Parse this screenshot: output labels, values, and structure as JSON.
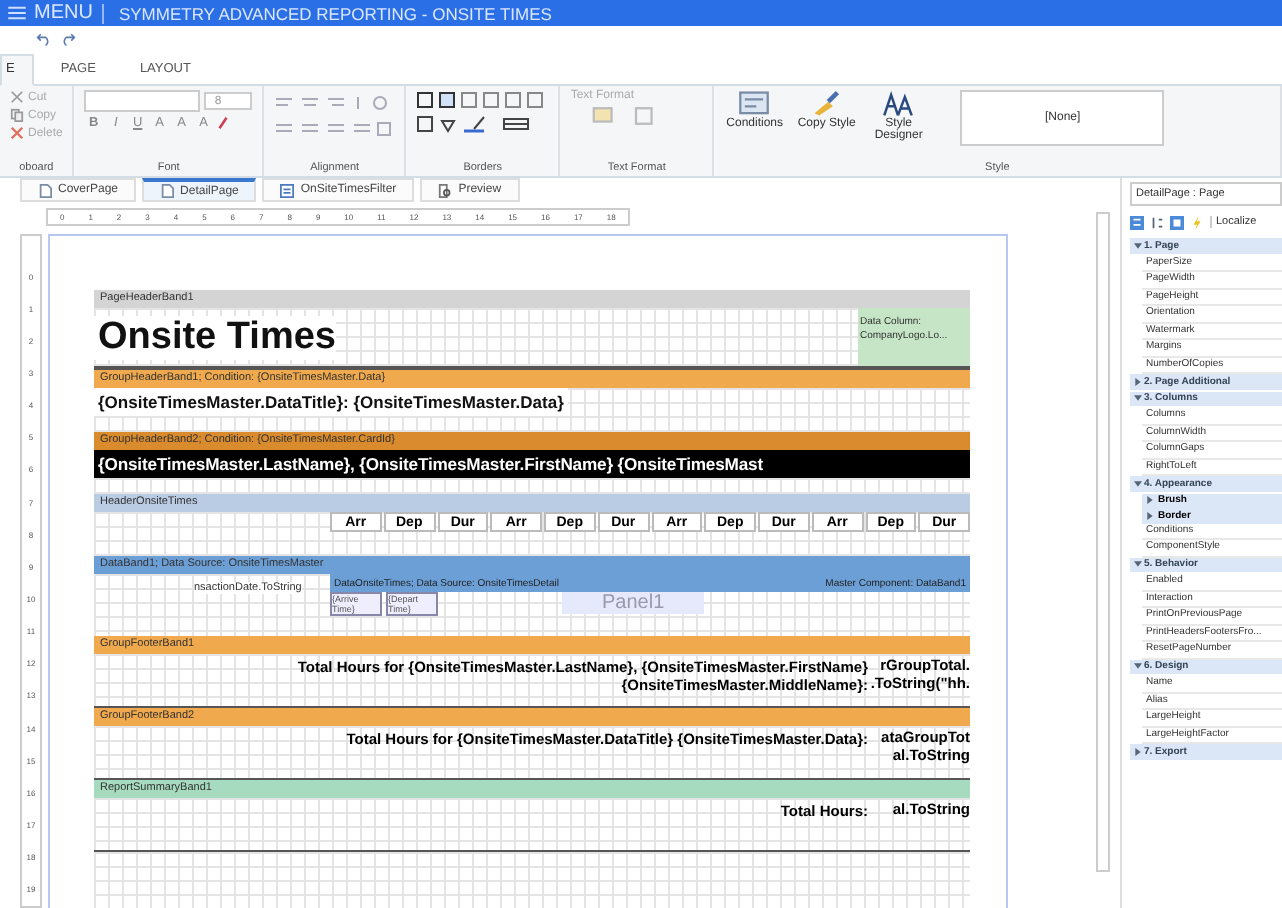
{
  "window": {
    "menu_label": "MENU",
    "title": "SYMMETRY ADVANCED REPORTING - ONSITE TIMES"
  },
  "ribbon_tabs": [
    {
      "label": "E",
      "selected": true
    },
    {
      "label": "PAGE",
      "selected": false
    },
    {
      "label": "LAYOUT",
      "selected": false
    }
  ],
  "clipboard": {
    "label": "oboard",
    "buttons": [
      {
        "kind": "cut",
        "label": "Cut",
        "disabled": true
      },
      {
        "kind": "copy",
        "label": "Copy",
        "disabled": true
      },
      {
        "kind": "delete",
        "label": "Delete",
        "disabled": true
      }
    ]
  },
  "font": {
    "label": "Font",
    "size": "8",
    "buttons": [
      "B",
      "I",
      "U",
      "A",
      "A",
      "A"
    ]
  },
  "alignment": {
    "label": "Alignment"
  },
  "borders": {
    "label": "Borders"
  },
  "text_format": {
    "label": "Text Format",
    "dropdown": "Text Format",
    "disabled": true
  },
  "style": {
    "label": "Style",
    "buttons": [
      {
        "kind": "conditions",
        "label": "Conditions"
      },
      {
        "kind": "copy_style",
        "label": "Copy Style"
      },
      {
        "kind": "style_designer",
        "label": "Style Designer"
      }
    ],
    "current": "[None]"
  },
  "page_tabs": [
    {
      "label": "CoverPage",
      "kind": "page",
      "selected": false
    },
    {
      "label": "DetailPage",
      "kind": "page",
      "selected": true
    },
    {
      "label": "OnSiteTimesFilter",
      "kind": "form",
      "selected": false
    },
    {
      "label": "Preview",
      "kind": "preview",
      "selected": false
    }
  ],
  "ruler": [
    "0",
    "1",
    "2",
    "3",
    "4",
    "5",
    "6",
    "7",
    "8",
    "9",
    "10",
    "11",
    "12",
    "13",
    "14",
    "15",
    "16",
    "17",
    "18"
  ],
  "vertical_ruler": [
    "0",
    "1",
    "2",
    "3",
    "4",
    "5",
    "6",
    "7",
    "8",
    "9",
    "10",
    "11",
    "12",
    "13",
    "14",
    "15",
    "16",
    "17",
    "18",
    "19"
  ],
  "bands": [
    {
      "kind": "page_header",
      "title": "PageHeaderBand1",
      "color": "#d4d4d4",
      "text": "Onsite Times",
      "side": [
        "Data Column:",
        "CompanyLogo.Lo..."
      ]
    },
    {
      "kind": "group_header",
      "title": "GroupHeaderBand1; Condition: {OnsiteTimesMaster.Data}",
      "color": "#f0a94c",
      "text": "{OnsiteTimesMaster.DataTitle}: {OnsiteTimesMaster.Data}",
      "inverted": false
    },
    {
      "kind": "group_header",
      "title": "GroupHeaderBand2; Condition: {OnsiteTimesMaster.CardId}",
      "color": "#d98b2e",
      "text": "{OnsiteTimesMaster.LastName}, {OnsiteTimesMaster.FirstName} {OnsiteTimesMast",
      "inverted": true
    },
    {
      "kind": "columns",
      "title": "HeaderOnsiteTimes",
      "color": "#b9cce4",
      "columns": [
        "Arr",
        "Dep",
        "Dur",
        "Arr",
        "Dep",
        "Dur",
        "Arr",
        "Dep",
        "Dur",
        "Arr",
        "Dep",
        "Dur"
      ]
    },
    {
      "kind": "data",
      "title": "DataBand1; Data Source: OnsiteTimesMaster",
      "color": "#6b9fd6",
      "fragment": "nsactionDate.ToString",
      "detail": {
        "title": "DataOnsiteTimes; Data Source: OnsiteTimesDetail",
        "master": "Master Component: DataBand1",
        "cells": [
          "{Arrive Time}",
          "{Depart Time}"
        ],
        "panel": "Panel1"
      }
    },
    {
      "kind": "footer",
      "title": "GroupFooterBand1",
      "color": "#f0a94c",
      "lines": [
        "Total Hours for {OnsiteTimesMaster.LastName}, {OnsiteTimesMaster.FirstName}",
        "{OnsiteTimesMaster.MiddleName}:"
      ],
      "value": [
        "rGroupTotal.",
        ".ToString(\"hh."
      ]
    },
    {
      "kind": "footer",
      "title": "GroupFooterBand2",
      "color": "#f0a94c",
      "lines": [
        "Total Hours for {OnsiteTimesMaster.DataTitle} {OnsiteTimesMaster.Data}:"
      ],
      "value": [
        "ataGroupTot",
        "al.ToString"
      ]
    },
    {
      "kind": "footer",
      "title": "ReportSummaryBand1",
      "color": "#a6dbbf",
      "lines": [
        "Total Hours:"
      ],
      "value": [
        "al.ToString"
      ]
    }
  ],
  "properties": {
    "object": "DetailPage : Page",
    "localize": "Localize",
    "categories": [
      {
        "label": "1. Page",
        "expanded": true,
        "items": [
          {
            "label": "PaperSize",
            "kind": "prop"
          },
          {
            "label": "PageWidth",
            "kind": "prop"
          },
          {
            "label": "PageHeight",
            "kind": "prop"
          },
          {
            "label": "Orientation",
            "kind": "prop"
          },
          {
            "label": "Watermark",
            "kind": "prop"
          },
          {
            "label": "Margins",
            "kind": "prop"
          },
          {
            "label": "NumberOfCopies",
            "kind": "prop"
          }
        ]
      },
      {
        "label": "2. Page Additional",
        "expanded": false
      },
      {
        "label": "3. Columns",
        "expanded": true,
        "items": [
          {
            "label": "Columns",
            "kind": "prop"
          },
          {
            "label": "ColumnWidth",
            "kind": "prop"
          },
          {
            "label": "ColumnGaps",
            "kind": "prop"
          },
          {
            "label": "RightToLeft",
            "kind": "prop"
          }
        ]
      },
      {
        "label": "4. Appearance",
        "expanded": true,
        "items": [
          {
            "label": "Brush",
            "kind": "group"
          },
          {
            "label": "Border",
            "kind": "group"
          },
          {
            "label": "Conditions",
            "kind": "prop"
          },
          {
            "label": "ComponentStyle",
            "kind": "prop"
          }
        ]
      },
      {
        "label": "5. Behavior",
        "expanded": true,
        "items": [
          {
            "label": "Enabled",
            "kind": "prop"
          },
          {
            "label": "Interaction",
            "kind": "prop"
          },
          {
            "label": "PrintOnPreviousPage",
            "kind": "prop"
          },
          {
            "label": "PrintHeadersFootersFro...",
            "kind": "prop"
          },
          {
            "label": "ResetPageNumber",
            "kind": "prop"
          }
        ]
      },
      {
        "label": "6. Design",
        "expanded": true,
        "items": [
          {
            "label": "Name",
            "kind": "prop"
          },
          {
            "label": "Alias",
            "kind": "prop"
          },
          {
            "label": "LargeHeight",
            "kind": "prop"
          },
          {
            "label": "LargeHeightFactor",
            "kind": "prop"
          }
        ]
      },
      {
        "label": "7. Export",
        "expanded": false
      }
    ]
  }
}
